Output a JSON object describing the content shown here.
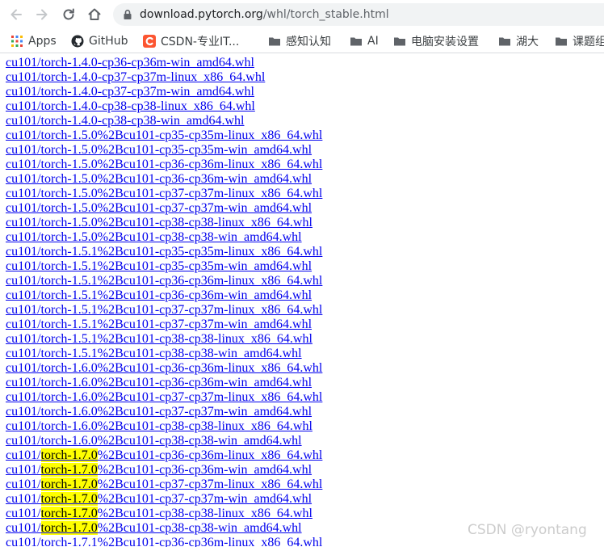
{
  "browser": {
    "url_host": "download.pytorch.org",
    "url_path": "/whl/torch_stable.html"
  },
  "bookmarks": [
    {
      "label": "Apps",
      "icon": "apps-grid-icon"
    },
    {
      "label": "GitHub",
      "icon": "github-icon"
    },
    {
      "label": "CSDN-专业IT...",
      "icon": "csdn-icon"
    },
    {
      "label": "感知认知",
      "icon": "folder-icon"
    },
    {
      "label": "AI",
      "icon": "folder-icon"
    },
    {
      "label": "电脑安装设置",
      "icon": "folder-icon"
    },
    {
      "label": "湖大",
      "icon": "folder-icon"
    },
    {
      "label": "课题组",
      "icon": "folder-icon"
    }
  ],
  "links": [
    {
      "pre": "cu101/torch-1.4.0-cp36-cp36m-win_amd64.whl",
      "hl": "",
      "post": ""
    },
    {
      "pre": "cu101/torch-1.4.0-cp37-cp37m-linux_x86_64.whl",
      "hl": "",
      "post": ""
    },
    {
      "pre": "cu101/torch-1.4.0-cp37-cp37m-win_amd64.whl",
      "hl": "",
      "post": ""
    },
    {
      "pre": "cu101/torch-1.4.0-cp38-cp38-linux_x86_64.whl",
      "hl": "",
      "post": ""
    },
    {
      "pre": "cu101/torch-1.4.0-cp38-cp38-win_amd64.whl",
      "hl": "",
      "post": ""
    },
    {
      "pre": "cu101/torch-1.5.0%2Bcu101-cp35-cp35m-linux_x86_64.whl",
      "hl": "",
      "post": ""
    },
    {
      "pre": "cu101/torch-1.5.0%2Bcu101-cp35-cp35m-win_amd64.whl",
      "hl": "",
      "post": ""
    },
    {
      "pre": "cu101/torch-1.5.0%2Bcu101-cp36-cp36m-linux_x86_64.whl",
      "hl": "",
      "post": ""
    },
    {
      "pre": "cu101/torch-1.5.0%2Bcu101-cp36-cp36m-win_amd64.whl",
      "hl": "",
      "post": ""
    },
    {
      "pre": "cu101/torch-1.5.0%2Bcu101-cp37-cp37m-linux_x86_64.whl",
      "hl": "",
      "post": ""
    },
    {
      "pre": "cu101/torch-1.5.0%2Bcu101-cp37-cp37m-win_amd64.whl",
      "hl": "",
      "post": ""
    },
    {
      "pre": "cu101/torch-1.5.0%2Bcu101-cp38-cp38-linux_x86_64.whl",
      "hl": "",
      "post": ""
    },
    {
      "pre": "cu101/torch-1.5.0%2Bcu101-cp38-cp38-win_amd64.whl",
      "hl": "",
      "post": ""
    },
    {
      "pre": "cu101/torch-1.5.1%2Bcu101-cp35-cp35m-linux_x86_64.whl",
      "hl": "",
      "post": ""
    },
    {
      "pre": "cu101/torch-1.5.1%2Bcu101-cp35-cp35m-win_amd64.whl",
      "hl": "",
      "post": ""
    },
    {
      "pre": "cu101/torch-1.5.1%2Bcu101-cp36-cp36m-linux_x86_64.whl",
      "hl": "",
      "post": ""
    },
    {
      "pre": "cu101/torch-1.5.1%2Bcu101-cp36-cp36m-win_amd64.whl",
      "hl": "",
      "post": ""
    },
    {
      "pre": "cu101/torch-1.5.1%2Bcu101-cp37-cp37m-linux_x86_64.whl",
      "hl": "",
      "post": ""
    },
    {
      "pre": "cu101/torch-1.5.1%2Bcu101-cp37-cp37m-win_amd64.whl",
      "hl": "",
      "post": ""
    },
    {
      "pre": "cu101/torch-1.5.1%2Bcu101-cp38-cp38-linux_x86_64.whl",
      "hl": "",
      "post": ""
    },
    {
      "pre": "cu101/torch-1.5.1%2Bcu101-cp38-cp38-win_amd64.whl",
      "hl": "",
      "post": ""
    },
    {
      "pre": "cu101/torch-1.6.0%2Bcu101-cp36-cp36m-linux_x86_64.whl",
      "hl": "",
      "post": ""
    },
    {
      "pre": "cu101/torch-1.6.0%2Bcu101-cp36-cp36m-win_amd64.whl",
      "hl": "",
      "post": ""
    },
    {
      "pre": "cu101/torch-1.6.0%2Bcu101-cp37-cp37m-linux_x86_64.whl",
      "hl": "",
      "post": ""
    },
    {
      "pre": "cu101/torch-1.6.0%2Bcu101-cp37-cp37m-win_amd64.whl",
      "hl": "",
      "post": ""
    },
    {
      "pre": "cu101/torch-1.6.0%2Bcu101-cp38-cp38-linux_x86_64.whl",
      "hl": "",
      "post": ""
    },
    {
      "pre": "cu101/torch-1.6.0%2Bcu101-cp38-cp38-win_amd64.whl",
      "hl": "",
      "post": ""
    },
    {
      "pre": "cu101/",
      "hl": "torch-1.7.0",
      "post": "%2Bcu101-cp36-cp36m-linux_x86_64.whl"
    },
    {
      "pre": "cu101/",
      "hl": "torch-1.7.0",
      "post": "%2Bcu101-cp36-cp36m-win_amd64.whl"
    },
    {
      "pre": "cu101/",
      "hl": "torch-1.7.0",
      "post": "%2Bcu101-cp37-cp37m-linux_x86_64.whl"
    },
    {
      "pre": "cu101/",
      "hl": "torch-1.7.0",
      "post": "%2Bcu101-cp37-cp37m-win_amd64.whl"
    },
    {
      "pre": "cu101/",
      "hl": "torch-1.7.0",
      "post": "%2Bcu101-cp38-cp38-linux_x86_64.whl"
    },
    {
      "pre": "cu101/",
      "hl": "torch-1.7.0",
      "post": "%2Bcu101-cp38-cp38-win_amd64.whl"
    },
    {
      "pre": "cu101/torch-1.7.1%2Bcu101-cp36-cp36m-linux_x86_64.whl",
      "hl": "",
      "post": ""
    }
  ],
  "watermark": "CSDN @ryontang",
  "colors": {
    "link": "#0000ee",
    "find_highlight": "#ffff00",
    "csdn_brand": "#fc5531"
  }
}
